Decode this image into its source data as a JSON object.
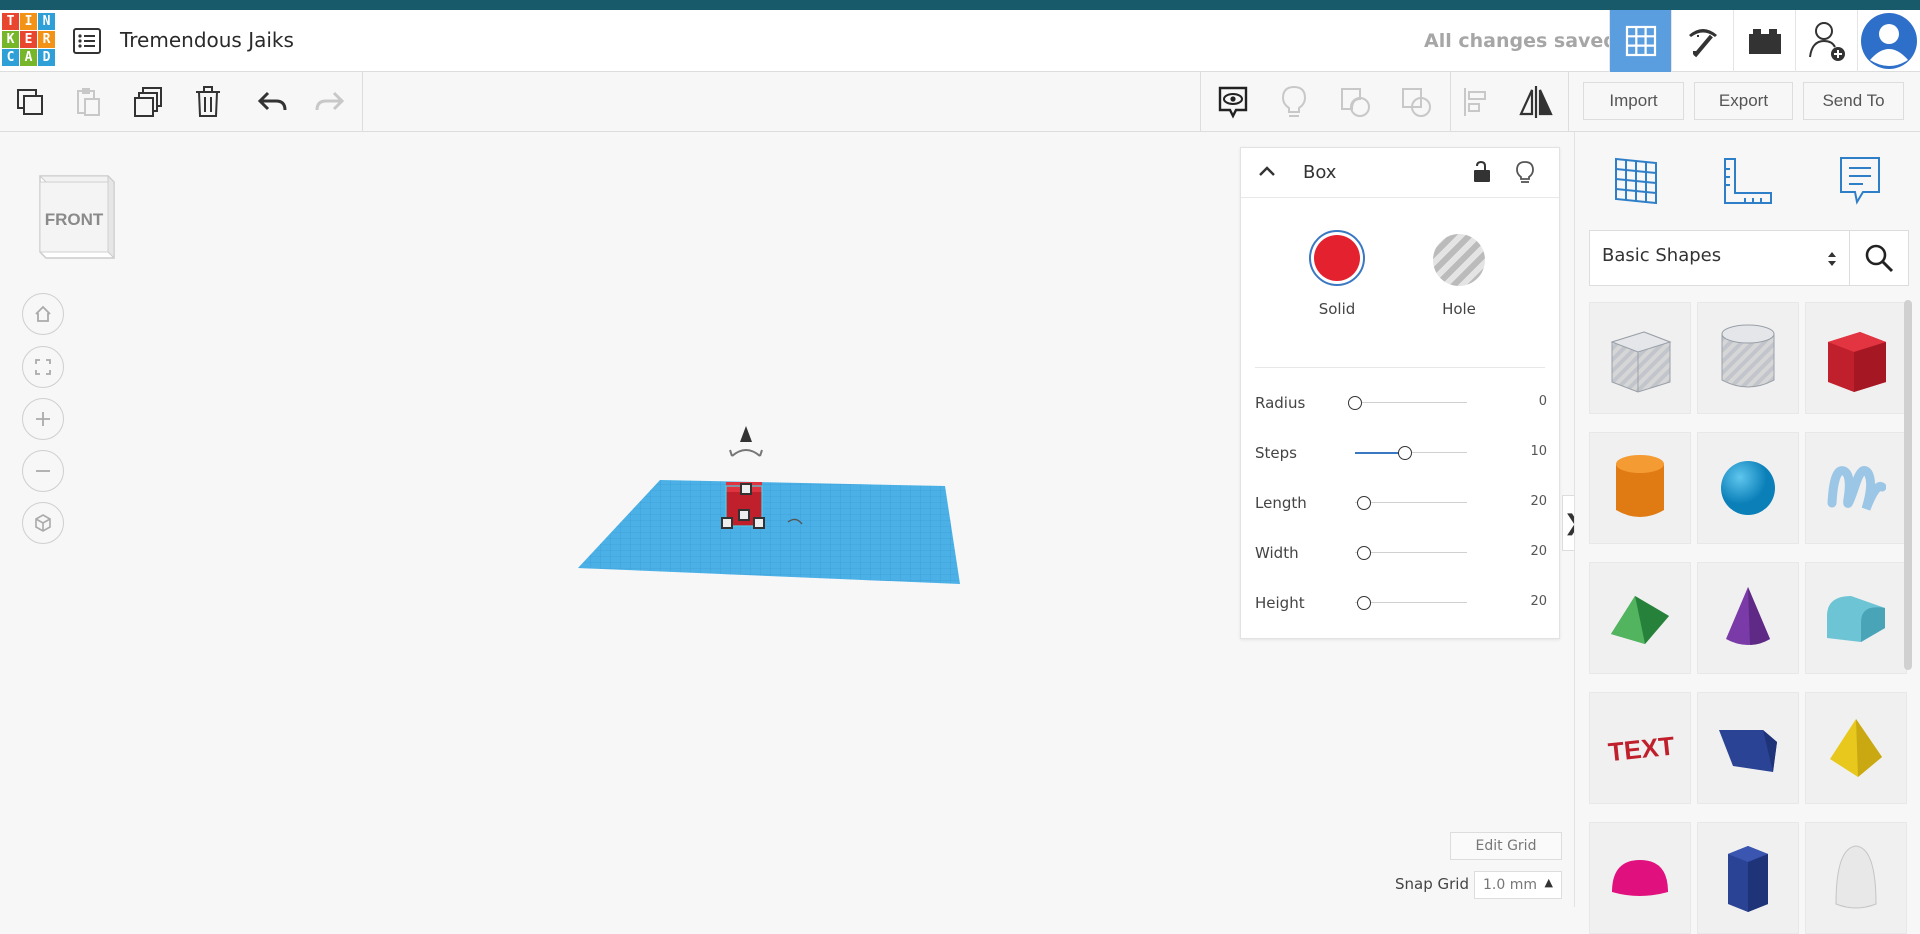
{
  "header": {
    "logo_letters": [
      "T",
      "I",
      "N",
      "K",
      "E",
      "R",
      "C",
      "A",
      "D"
    ],
    "logo_colors": [
      "#e8462e",
      "#f29318",
      "#2f9fd8",
      "#77b52a",
      "#e8462e",
      "#f29318",
      "#2f9fd8",
      "#77b52a",
      "#2f9fd8"
    ],
    "project_title": "Tremendous Jaiks",
    "save_status": "All changes saved",
    "buttons": [
      "3d-design-view",
      "codeblocks",
      "bricks",
      "invite-user",
      "user-avatar"
    ]
  },
  "toolbar": {
    "left_tools": [
      "copy",
      "paste",
      "duplicate",
      "delete",
      "undo",
      "redo"
    ],
    "right_tools": [
      "notes",
      "show-hide",
      "group",
      "ungroup",
      "align",
      "mirror"
    ],
    "import_label": "Import",
    "export_label": "Export",
    "send_to_label": "Send To"
  },
  "viewcube": {
    "face_label": "FRONT"
  },
  "nav_controls": [
    "home-view",
    "fit-view",
    "zoom-in",
    "zoom-out",
    "projection-toggle"
  ],
  "inspector": {
    "title": "Box",
    "solid_label": "Solid",
    "hole_label": "Hole",
    "solid_color": "#e3212f",
    "properties": [
      {
        "label": "Radius",
        "value": "0",
        "fraction": 0.0
      },
      {
        "label": "Steps",
        "value": "10",
        "fraction": 0.45
      },
      {
        "label": "Length",
        "value": "20",
        "fraction": 0.08
      },
      {
        "label": "Width",
        "value": "20",
        "fraction": 0.08
      },
      {
        "label": "Height",
        "value": "20",
        "fraction": 0.08
      }
    ]
  },
  "right_panel": {
    "tabs": [
      "workplane",
      "ruler",
      "notes"
    ],
    "shape_category": "Basic Shapes",
    "shapes": [
      "box-hole",
      "cylinder-hole",
      "box",
      "cylinder",
      "sphere",
      "scribble",
      "roof",
      "cone",
      "round-roof",
      "text",
      "wedge",
      "pyramid",
      "half-sphere",
      "polygon",
      "paraboloid"
    ]
  },
  "grid_controls": {
    "edit_grid_label": "Edit Grid",
    "snap_grid_label": "Snap Grid",
    "snap_grid_value": "1.0 mm"
  },
  "colors": {
    "accent": "#5b9ee0",
    "workplane": "#4ab0e6",
    "box_red": "#d0212d"
  }
}
